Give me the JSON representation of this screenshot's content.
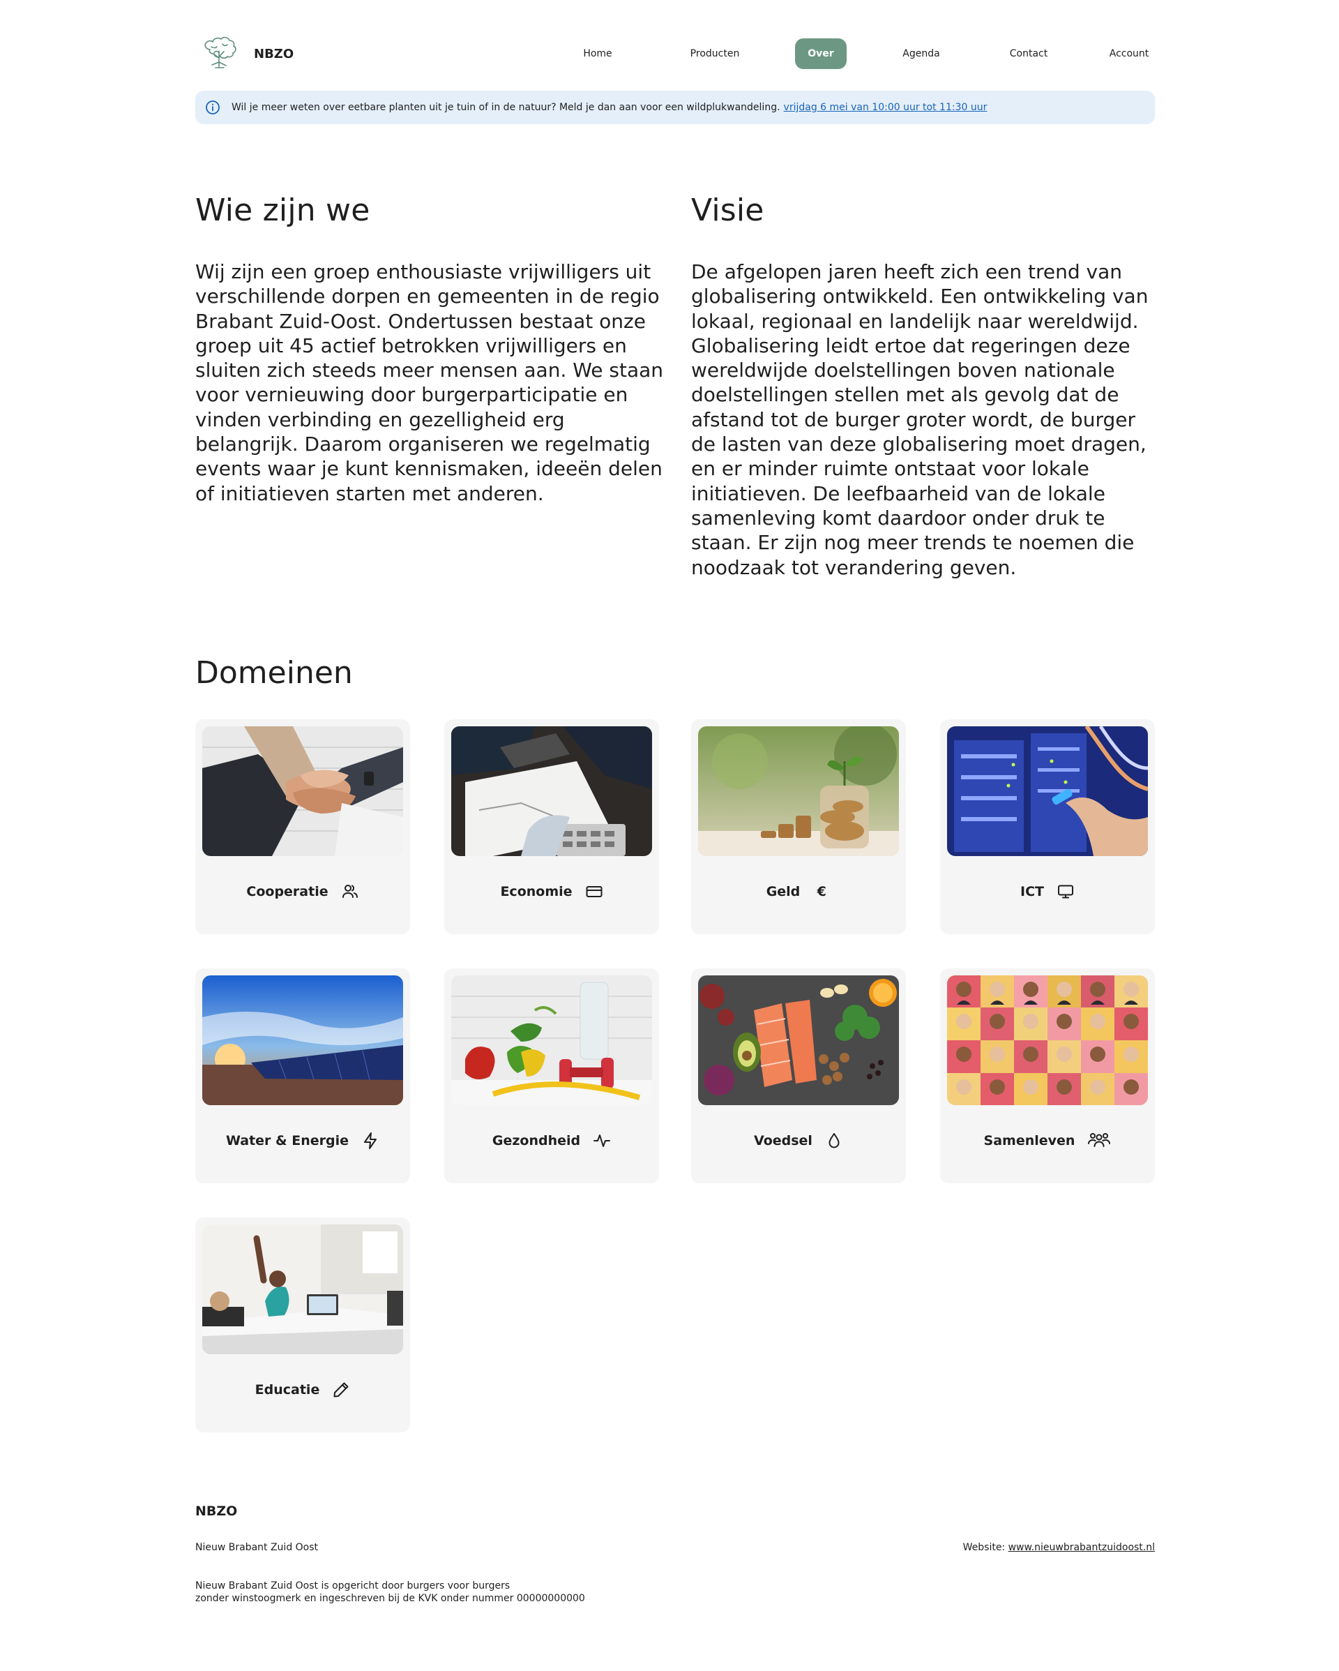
{
  "header": {
    "brand": "NBZO",
    "logo_icon": "tree-icon",
    "nav": [
      {
        "label": "Home",
        "active": false
      },
      {
        "label": "Producten",
        "active": false
      },
      {
        "label": "Over",
        "active": true
      },
      {
        "label": "Agenda",
        "active": false
      },
      {
        "label": "Contact",
        "active": false
      },
      {
        "label": "Account",
        "active": false
      }
    ],
    "accent_color": "#6c9883"
  },
  "banner": {
    "icon": "info-icon",
    "text": "Wil je meer weten over eetbare planten uit je tuin of in de natuur? Meld je dan aan voor een wildplukwandeling.",
    "link": "vrijdag 6 mei van 10:00 uur tot 11:30 uur",
    "background": "#e4eff9"
  },
  "about": {
    "title": "Wie zijn we",
    "body": "Wij zijn een groep enthousiaste vrijwilligers uit verschillende dorpen en gemeenten in de regio Brabant Zuid-Oost. Ondertussen bestaat onze groep uit 45 actief betrokken vrijwilligers en sluiten zich steeds meer mensen aan. We staan voor vernieuwing door burgerparticipatie en vinden verbinding en gezelligheid erg belangrijk. Daarom organiseren we regelmatig events waar je kunt kennismaken, ideeën delen of initiatieven starten met anderen."
  },
  "vision": {
    "title": "Visie",
    "body": "De afgelopen jaren heeft zich een trend van globalisering ontwikkeld. Een ontwikkeling van lokaal, regionaal en landelijk naar wereldwijd. Globalisering leidt ertoe dat regeringen deze wereldwijde doelstellingen boven nationale doelstellingen stellen met als gevolg dat de afstand tot de burger groter wordt, de burger de lasten van deze globalisering moet dragen, en er minder ruimte ontstaat voor lokale initiatieven. De leefbaarheid van de lokale samenleving komt daardoor onder druk te staan. Er zijn nog meer trends te noemen die noodzaak tot verandering geven."
  },
  "domains": {
    "title": "Domeinen",
    "items": [
      {
        "label": "Cooperatie",
        "icon": "users-icon",
        "image": "hands-together-photo"
      },
      {
        "label": "Economie",
        "icon": "credit-card-icon",
        "image": "desk-calculator-photo"
      },
      {
        "label": "Geld",
        "icon": "euro-icon",
        "glyph": "€",
        "image": "coin-jar-plant-photo"
      },
      {
        "label": "ICT",
        "icon": "monitor-icon",
        "image": "server-cables-photo"
      },
      {
        "label": "Water & Energie",
        "icon": "lightning-icon",
        "image": "solar-panels-water-photo"
      },
      {
        "label": "Gezondheid",
        "icon": "activity-pulse-icon",
        "image": "vegetables-dumbbell-photo"
      },
      {
        "label": "Voedsel",
        "icon": "droplet-icon",
        "image": "healthy-food-photo"
      },
      {
        "label": "Samenleven",
        "icon": "group-icon",
        "image": "faces-collage-photo"
      },
      {
        "label": "Educatie",
        "icon": "pencil-icon",
        "image": "classroom-photo"
      }
    ]
  },
  "footer": {
    "title": "NBZO",
    "subtitle": "Nieuw Brabant Zuid Oost",
    "website_label": "Website:",
    "website_link": "www.nieuwbrabantzuidoost.nl",
    "desc_line1": "Nieuw Brabant Zuid Oost is opgericht door burgers voor burgers",
    "desc_line2": "zonder winstoogmerk en ingeschreven bij de KVK onder nummer 00000000000"
  }
}
